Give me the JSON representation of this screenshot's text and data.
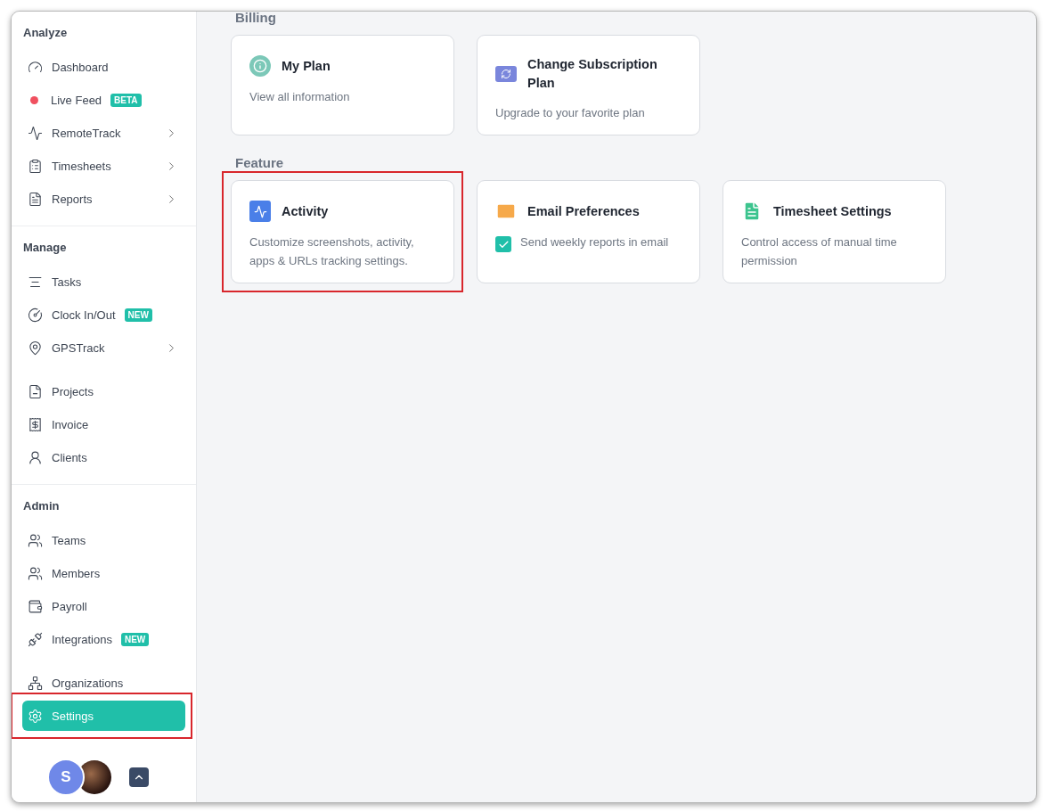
{
  "sidebar": {
    "sections": [
      {
        "title": "Analyze",
        "groups": [
          [
            {
              "label": "Dashboard",
              "kind": "icon",
              "submenu": false,
              "selected": false
            },
            {
              "label": "Live Feed",
              "kind": "dot",
              "color": "#f0505f",
              "badge": "BETA",
              "submenu": false,
              "selected": false
            },
            {
              "label": "RemoteTrack",
              "kind": "icon",
              "submenu": true,
              "selected": false
            },
            {
              "label": "Timesheets",
              "kind": "icon",
              "submenu": true,
              "selected": false
            },
            {
              "label": "Reports",
              "kind": "icon",
              "submenu": true,
              "selected": false
            }
          ]
        ]
      },
      {
        "title": "Manage",
        "groups": [
          [
            {
              "label": "Tasks",
              "kind": "icon",
              "submenu": false,
              "selected": false
            },
            {
              "label": "Clock In/Out",
              "kind": "icon",
              "badge": "NEW",
              "submenu": false,
              "selected": false
            },
            {
              "label": "GPSTrack",
              "kind": "icon",
              "submenu": true,
              "selected": false
            }
          ],
          [
            {
              "label": "Projects",
              "kind": "icon",
              "submenu": false,
              "selected": false
            },
            {
              "label": "Invoice",
              "kind": "icon",
              "submenu": false,
              "selected": false
            },
            {
              "label": "Clients",
              "kind": "icon",
              "submenu": false,
              "selected": false
            }
          ]
        ]
      },
      {
        "title": "Admin",
        "groups": [
          [
            {
              "label": "Teams",
              "kind": "icon",
              "submenu": false,
              "selected": false
            },
            {
              "label": "Members",
              "kind": "icon",
              "submenu": false,
              "selected": false
            },
            {
              "label": "Payroll",
              "kind": "icon",
              "submenu": false,
              "selected": false
            },
            {
              "label": "Integrations",
              "kind": "icon",
              "badge": "NEW",
              "submenu": false,
              "selected": false
            }
          ],
          [
            {
              "label": "Organizations",
              "kind": "icon",
              "submenu": false,
              "selected": false
            },
            {
              "label": "Settings",
              "kind": "icon",
              "submenu": false,
              "selected": true,
              "highlighted": true
            }
          ]
        ]
      }
    ],
    "footer": {
      "avatar_initial": "S"
    }
  },
  "sections": [
    {
      "title": "Billing",
      "cards": [
        {
          "title": "My Plan",
          "description": "View all information",
          "kind": "text"
        },
        {
          "title": "Change Subscription Plan",
          "description": "Upgrade to your favorite plan",
          "kind": "text"
        }
      ]
    },
    {
      "title": "Feature",
      "cards": [
        {
          "title": "Activity",
          "description": "Customize screenshots, activity, apps & URLs tracking settings.",
          "kind": "text",
          "highlighted": true
        },
        {
          "title": "Email Preferences",
          "description": "Send weekly reports in email",
          "kind": "checkbox",
          "checked": true
        },
        {
          "title": "Timesheet Settings",
          "description": "Control access of manual time permission",
          "kind": "text"
        }
      ]
    }
  ]
}
